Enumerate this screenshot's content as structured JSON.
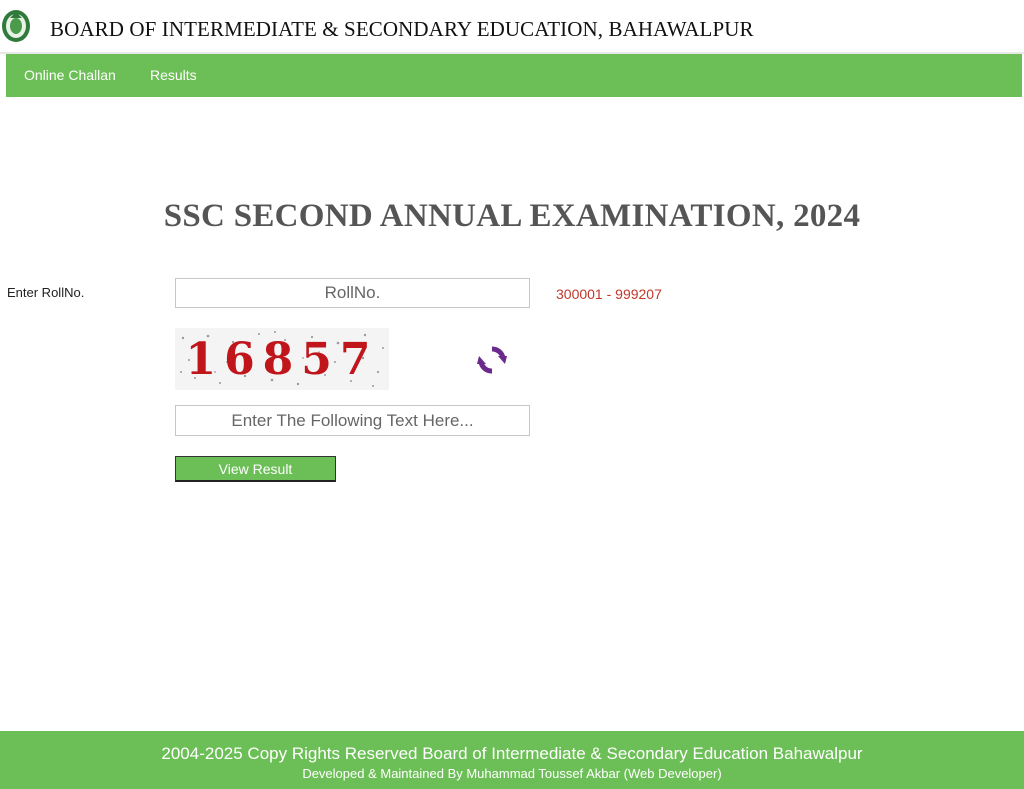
{
  "header": {
    "title": "BOARD OF INTERMEDIATE & SECONDARY EDUCATION, BAHAWALPUR",
    "logo_icon": "board-seal-icon"
  },
  "nav": {
    "items": [
      {
        "label": "Online Challan"
      },
      {
        "label": "Results"
      }
    ]
  },
  "main": {
    "exam_title": "SSC SECOND ANNUAL EXAMINATION, 2024",
    "roll_label": "Enter RollNo.",
    "roll_placeholder": "RollNo.",
    "roll_range": "300001 - 999207",
    "captcha_text": "16857",
    "captcha_placeholder": "Enter The Following Text Here...",
    "view_button": "View Result",
    "refresh_icon": "refresh-icon"
  },
  "footer": {
    "line1": "2004-2025 Copy Rights Reserved Board of Intermediate & Secondary Education Bahawalpur",
    "line2": "Developed & Maintained By Muhammad Toussef Akbar (Web Developer)"
  },
  "colors": {
    "brand_green": "#6cbf56",
    "range_red": "#c0392b",
    "captcha_red": "#c0151b",
    "refresh_purple": "#6b2a8c"
  }
}
